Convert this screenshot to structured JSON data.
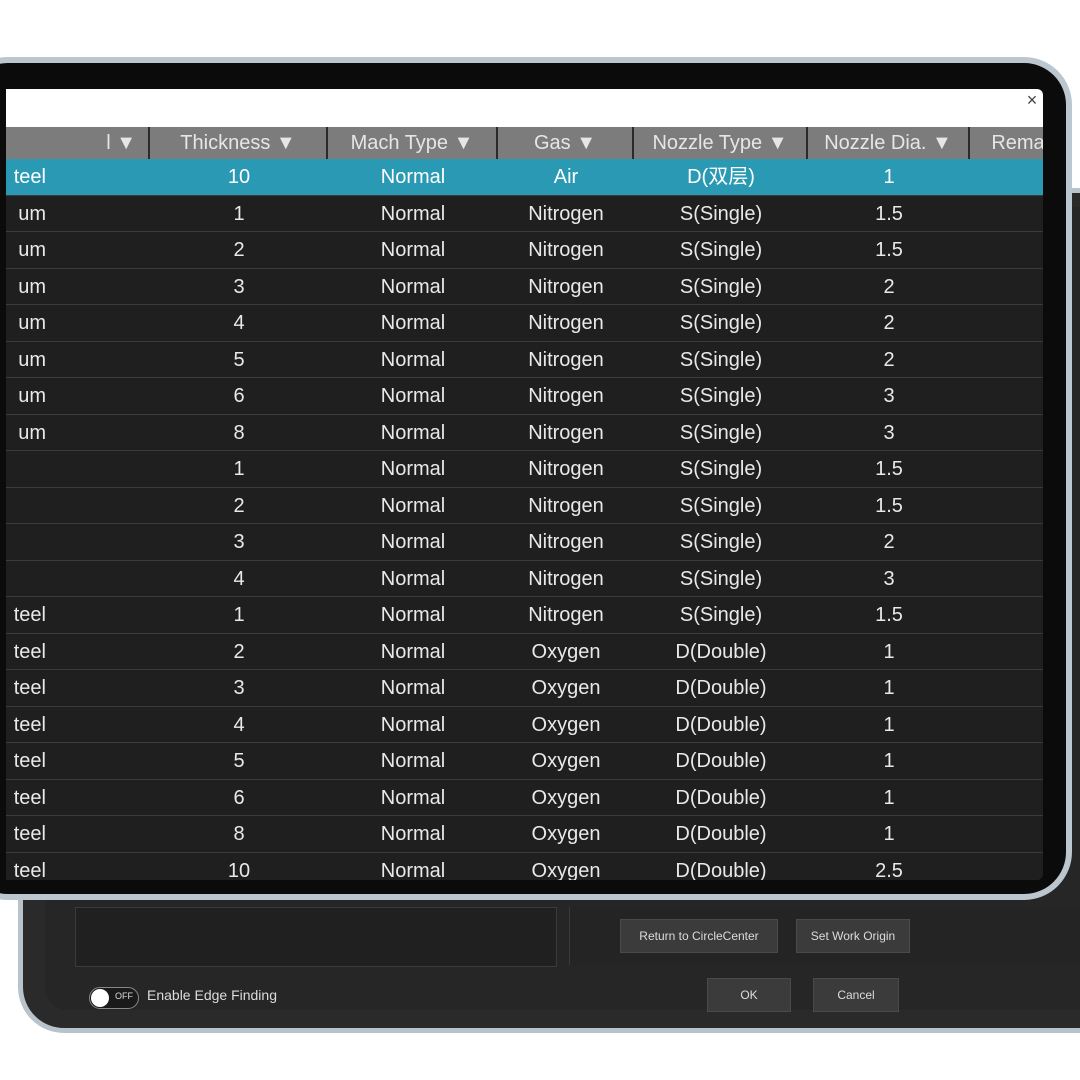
{
  "back_window": {
    "buttons": {
      "return_to_circle_center": "Return to CircleCenter",
      "set_work_origin": "Set Work Origin",
      "ok": "OK",
      "cancel": "Cancel"
    },
    "toggle": {
      "state_text": "OFF",
      "label": "Enable Edge Finding"
    }
  },
  "front_window": {
    "close_glyph": "×",
    "columns": [
      "l ▼",
      "Thickness ▼",
      "Mach Type ▼",
      "Gas ▼",
      "Nozzle Type ▼",
      "Nozzle Dia. ▼",
      "Remark ▼"
    ],
    "rows": [
      {
        "material": "teel",
        "thickness": "10",
        "mach_type": "Normal",
        "gas": "Air",
        "nozzle_type": "D(双层)",
        "nozzle_dia": "1",
        "remark": "",
        "selected": true
      },
      {
        "material": "um",
        "thickness": "1",
        "mach_type": "Normal",
        "gas": "Nitrogen",
        "nozzle_type": "S(Single)",
        "nozzle_dia": "1.5",
        "remark": ""
      },
      {
        "material": "um",
        "thickness": "2",
        "mach_type": "Normal",
        "gas": "Nitrogen",
        "nozzle_type": "S(Single)",
        "nozzle_dia": "1.5",
        "remark": ""
      },
      {
        "material": "um",
        "thickness": "3",
        "mach_type": "Normal",
        "gas": "Nitrogen",
        "nozzle_type": "S(Single)",
        "nozzle_dia": "2",
        "remark": ""
      },
      {
        "material": "um",
        "thickness": "4",
        "mach_type": "Normal",
        "gas": "Nitrogen",
        "nozzle_type": "S(Single)",
        "nozzle_dia": "2",
        "remark": ""
      },
      {
        "material": "um",
        "thickness": "5",
        "mach_type": "Normal",
        "gas": "Nitrogen",
        "nozzle_type": "S(Single)",
        "nozzle_dia": "2",
        "remark": ""
      },
      {
        "material": "um",
        "thickness": "6",
        "mach_type": "Normal",
        "gas": "Nitrogen",
        "nozzle_type": "S(Single)",
        "nozzle_dia": "3",
        "remark": ""
      },
      {
        "material": "um",
        "thickness": "8",
        "mach_type": "Normal",
        "gas": "Nitrogen",
        "nozzle_type": "S(Single)",
        "nozzle_dia": "3",
        "remark": ""
      },
      {
        "material": "",
        "thickness": "1",
        "mach_type": "Normal",
        "gas": "Nitrogen",
        "nozzle_type": "S(Single)",
        "nozzle_dia": "1.5",
        "remark": ""
      },
      {
        "material": "",
        "thickness": "2",
        "mach_type": "Normal",
        "gas": "Nitrogen",
        "nozzle_type": "S(Single)",
        "nozzle_dia": "1.5",
        "remark": ""
      },
      {
        "material": "",
        "thickness": "3",
        "mach_type": "Normal",
        "gas": "Nitrogen",
        "nozzle_type": "S(Single)",
        "nozzle_dia": "2",
        "remark": ""
      },
      {
        "material": "",
        "thickness": "4",
        "mach_type": "Normal",
        "gas": "Nitrogen",
        "nozzle_type": "S(Single)",
        "nozzle_dia": "3",
        "remark": ""
      },
      {
        "material": "teel",
        "thickness": "1",
        "mach_type": "Normal",
        "gas": "Nitrogen",
        "nozzle_type": "S(Single)",
        "nozzle_dia": "1.5",
        "remark": ""
      },
      {
        "material": "teel",
        "thickness": "2",
        "mach_type": "Normal",
        "gas": "Oxygen",
        "nozzle_type": "D(Double)",
        "nozzle_dia": "1",
        "remark": ""
      },
      {
        "material": "teel",
        "thickness": "3",
        "mach_type": "Normal",
        "gas": "Oxygen",
        "nozzle_type": "D(Double)",
        "nozzle_dia": "1",
        "remark": ""
      },
      {
        "material": "teel",
        "thickness": "4",
        "mach_type": "Normal",
        "gas": "Oxygen",
        "nozzle_type": "D(Double)",
        "nozzle_dia": "1",
        "remark": ""
      },
      {
        "material": "teel",
        "thickness": "5",
        "mach_type": "Normal",
        "gas": "Oxygen",
        "nozzle_type": "D(Double)",
        "nozzle_dia": "1",
        "remark": ""
      },
      {
        "material": "teel",
        "thickness": "6",
        "mach_type": "Normal",
        "gas": "Oxygen",
        "nozzle_type": "D(Double)",
        "nozzle_dia": "1",
        "remark": ""
      },
      {
        "material": "teel",
        "thickness": "8",
        "mach_type": "Normal",
        "gas": "Oxygen",
        "nozzle_type": "D(Double)",
        "nozzle_dia": "1",
        "remark": ""
      },
      {
        "material": "teel",
        "thickness": "10",
        "mach_type": "Normal",
        "gas": "Oxygen",
        "nozzle_type": "D(Double)",
        "nozzle_dia": "2.5",
        "remark": ""
      }
    ]
  },
  "colors": {
    "selected_row": "#2a9ab4",
    "header_bg": "#7c7c7c",
    "grid_bg": "#1f1f1f",
    "bezel": "#bcc6ce"
  }
}
